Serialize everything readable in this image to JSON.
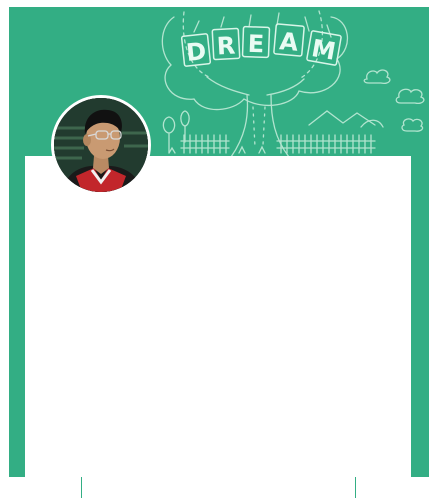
{
  "cover": {
    "banner_text": "DREAM",
    "banner_letters": [
      "D",
      "R",
      "E",
      "A",
      "M"
    ],
    "background_color": "#33ae84",
    "illustration": "tree-with-dream-signs-icon"
  },
  "profile": {
    "avatar": "user-avatar-photo",
    "avatar_border_color": "#ffffff"
  },
  "content": {
    "panel_color": "#ffffff"
  }
}
